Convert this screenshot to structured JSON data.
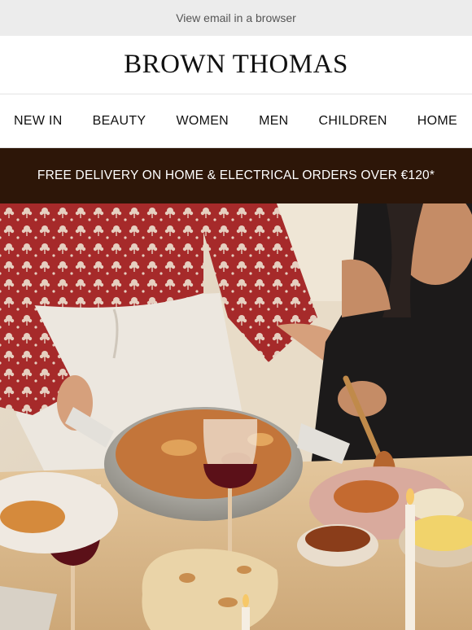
{
  "preheader": {
    "view_in_browser": "View email in a browser"
  },
  "brand": {
    "name": "BROWN THOMAS"
  },
  "nav": {
    "items": [
      {
        "label": "NEW IN"
      },
      {
        "label": "BEAUTY"
      },
      {
        "label": "WOMEN"
      },
      {
        "label": "MEN"
      },
      {
        "label": "CHILDREN"
      },
      {
        "label": "HOME"
      }
    ]
  },
  "promo": {
    "text": "FREE DELIVERY ON HOME & ELECTRICAL ORDERS OVER €120*"
  },
  "colors": {
    "promo_background": "#2d1608",
    "topbar_background": "#ececec",
    "hero_shirt": "#a62a2a",
    "hero_table": "#d9ba8e"
  }
}
